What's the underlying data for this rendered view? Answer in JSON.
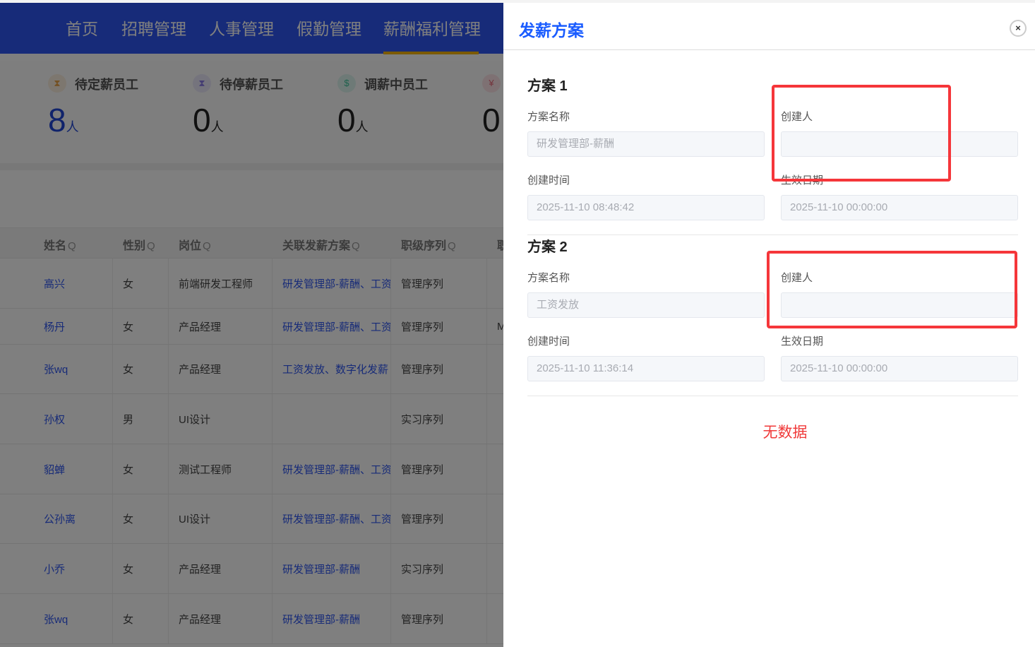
{
  "nav": {
    "items": [
      "首页",
      "招聘管理",
      "人事管理",
      "假勤管理",
      "薪酬福利管理"
    ],
    "active": 4
  },
  "stats": [
    {
      "label": "待定薪员工",
      "value": "8",
      "unit": "人",
      "icon": "hourglass-icon"
    },
    {
      "label": "待停薪员工",
      "value": "0",
      "unit": "人",
      "icon": "hourglass-icon"
    },
    {
      "label": "调薪中员工",
      "value": "0",
      "unit": "人",
      "icon": "coins-icon"
    },
    {
      "label": "",
      "value": "0",
      "unit": "",
      "icon": "money-bag-icon"
    }
  ],
  "table": {
    "headers": [
      "姓名",
      "性别",
      "岗位",
      "关联发薪方案",
      "职级序列",
      "职"
    ],
    "rows": [
      [
        "高兴",
        "女",
        "前端研发工程师",
        "研发管理部-薪酬、工资发放",
        "管理序列",
        ""
      ],
      [
        "杨丹",
        "女",
        "产品经理",
        "研发管理部-薪酬、工资发放",
        "管理序列",
        "M"
      ],
      [
        "张wq",
        "女",
        "产品经理",
        "工资发放、数字化发薪",
        "管理序列",
        ""
      ],
      [
        "孙权",
        "男",
        "UI设计",
        "",
        "实习序列",
        ""
      ],
      [
        "貂蝉",
        "女",
        "测试工程师",
        "研发管理部-薪酬、工资发放",
        "管理序列",
        ""
      ],
      [
        "公孙离",
        "女",
        "UI设计",
        "研发管理部-薪酬、工资发放",
        "管理序列",
        ""
      ],
      [
        "小乔",
        "女",
        "产品经理",
        "研发管理部-薪酬",
        "实习序列",
        ""
      ],
      [
        "张wq",
        "女",
        "产品经理",
        "研发管理部-薪酬",
        "管理序列",
        ""
      ]
    ]
  },
  "panel": {
    "title": "发薪方案",
    "close": "×",
    "labels": {
      "name": "方案名称",
      "creator": "创建人",
      "created": "创建时间",
      "effective": "生效日期"
    },
    "plans": [
      {
        "title": "方案 1",
        "name": "研发管理部-薪酬",
        "creator": "",
        "created": "2025-11-10 08:48:42",
        "effective": "2025-11-10 00:00:00"
      },
      {
        "title": "方案 2",
        "name": "工资发放",
        "creator": "",
        "created": "2025-11-10 11:36:14",
        "effective": "2025-11-10 00:00:00"
      }
    ],
    "empty": "无数据"
  }
}
